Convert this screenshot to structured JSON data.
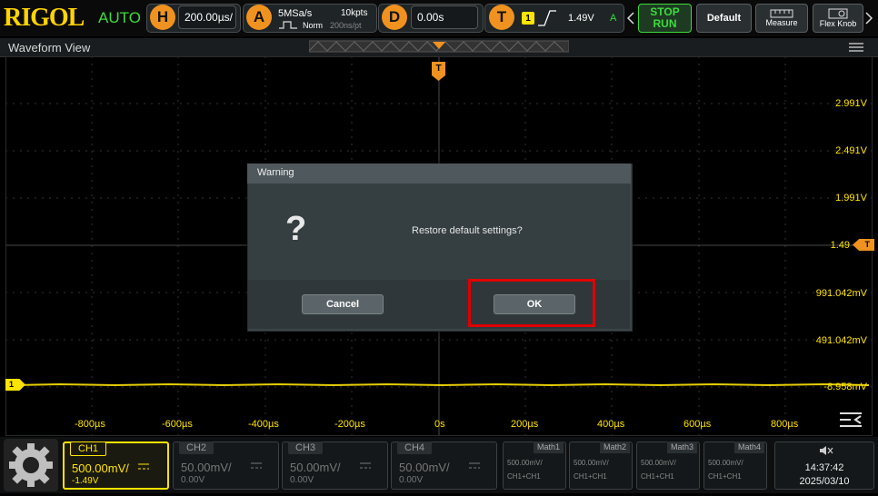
{
  "top_bar": {
    "brand": "RIGOL",
    "run_mode": "AUTO",
    "horizontal": {
      "key": "H",
      "value": "200.00µs/"
    },
    "acquire": {
      "key": "A",
      "sample_rate": "5MSa/s",
      "mode": "Norm",
      "memory": "10kpts",
      "pts_time": "200ns/pt"
    },
    "delay": {
      "key": "D",
      "value": "0.00s"
    },
    "trigger": {
      "key": "T",
      "source": "1",
      "level": "1.49V",
      "status": "A"
    },
    "stop_label": "STOP",
    "run_label": "RUN",
    "default_label": "Default",
    "measure_label": "Measure",
    "flex_knob_label": "Flex Knob"
  },
  "waveform_view": {
    "title": "Waveform View",
    "trigger_marker": "T",
    "channel_marker": "1",
    "trigger_level_marker": "T",
    "levels": [
      "2.991V",
      "2.491V",
      "1.991V",
      "1.49",
      "991.042mV",
      "491.042mV",
      "-8.958mV"
    ],
    "time_labels": [
      "-800µs",
      "-600µs",
      "-400µs",
      "-200µs",
      "0s",
      "200µs",
      "400µs",
      "600µs",
      "800µs"
    ]
  },
  "dialog": {
    "title": "Warning",
    "message": "Restore default settings?",
    "cancel_label": "Cancel",
    "ok_label": "OK"
  },
  "channels": [
    {
      "name": "CH1",
      "scale": "500.00mV/",
      "offset": "-1.49V",
      "active": true
    },
    {
      "name": "CH2",
      "scale": "50.00mV/",
      "offset": "0.00V",
      "active": false
    },
    {
      "name": "CH3",
      "scale": "50.00mV/",
      "offset": "0.00V",
      "active": false
    },
    {
      "name": "CH4",
      "scale": "50.00mV/",
      "offset": "0.00V",
      "active": false
    }
  ],
  "math": [
    {
      "name": "Math1",
      "scale": "500.00mV/",
      "expr": "CH1+CH1"
    },
    {
      "name": "Math2",
      "scale": "500.00mV/",
      "expr": "CH1+CH1"
    },
    {
      "name": "Math3",
      "scale": "500.00mV/",
      "expr": "CH1+CH1"
    },
    {
      "name": "Math4",
      "scale": "500.00mV/",
      "expr": "CH1+CH1"
    }
  ],
  "status": {
    "time": "14:37:42",
    "date": "2025/03/10",
    "sound_icon": "speaker-muted-icon"
  },
  "colors": {
    "ch1": "#ffe400",
    "accent": "#f0921f",
    "highlight": "#e00000",
    "auto": "#3ddc3d"
  }
}
